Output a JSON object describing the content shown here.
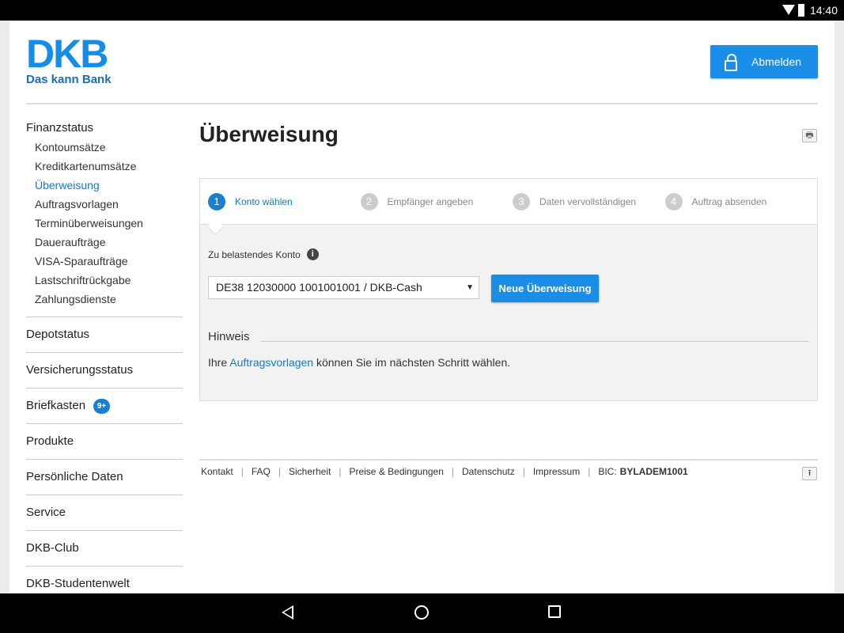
{
  "status_bar": {
    "time": "14:40"
  },
  "logo": {
    "name": "DKB",
    "tagline": "Das kann Bank"
  },
  "header": {
    "logout_label": "Abmelden"
  },
  "sidebar": {
    "finanzstatus": {
      "label": "Finanzstatus",
      "items": [
        "Kontoumsätze",
        "Kreditkartenumsätze",
        "Überweisung",
        "Auftragsvorlagen",
        "Terminüberweisungen",
        "Daueraufträge",
        "VISA-Sparaufträge",
        "Lastschriftrückgabe",
        "Zahlungsdienste"
      ],
      "active": "Überweisung"
    },
    "sections": [
      "Depotstatus",
      "Versicherungsstatus",
      "Briefkasten",
      "Produkte",
      "Persönliche Daten",
      "Service",
      "DKB-Club",
      "DKB-Studentenwelt"
    ],
    "briefkasten_badge": "9+"
  },
  "main": {
    "title": "Überweisung",
    "steps": [
      {
        "n": "1",
        "label": "Konto wählen"
      },
      {
        "n": "2",
        "label": "Empfänger angeben"
      },
      {
        "n": "3",
        "label": "Daten vervollständigen"
      },
      {
        "n": "4",
        "label": "Auftrag absenden"
      }
    ],
    "account_label": "Zu belastendes Konto",
    "account_value": "DE38 12030000 1001001001 / DKB-Cash",
    "new_button": "Neue Überweisung",
    "hint_title": "Hinweis",
    "hint_pre": "Ihre ",
    "hint_link": "Auftragsvorlagen",
    "hint_post": " können Sie im nächsten Schritt wählen."
  },
  "footer": {
    "links": [
      "Kontakt",
      "FAQ",
      "Sicherheit",
      "Preise & Bedingungen",
      "Datenschutz",
      "Impressum"
    ],
    "bic_label": "BIC:",
    "bic_value": "BYLADEM1001"
  },
  "colors": {
    "brand": "#148dea",
    "link": "#1a7ab5"
  }
}
